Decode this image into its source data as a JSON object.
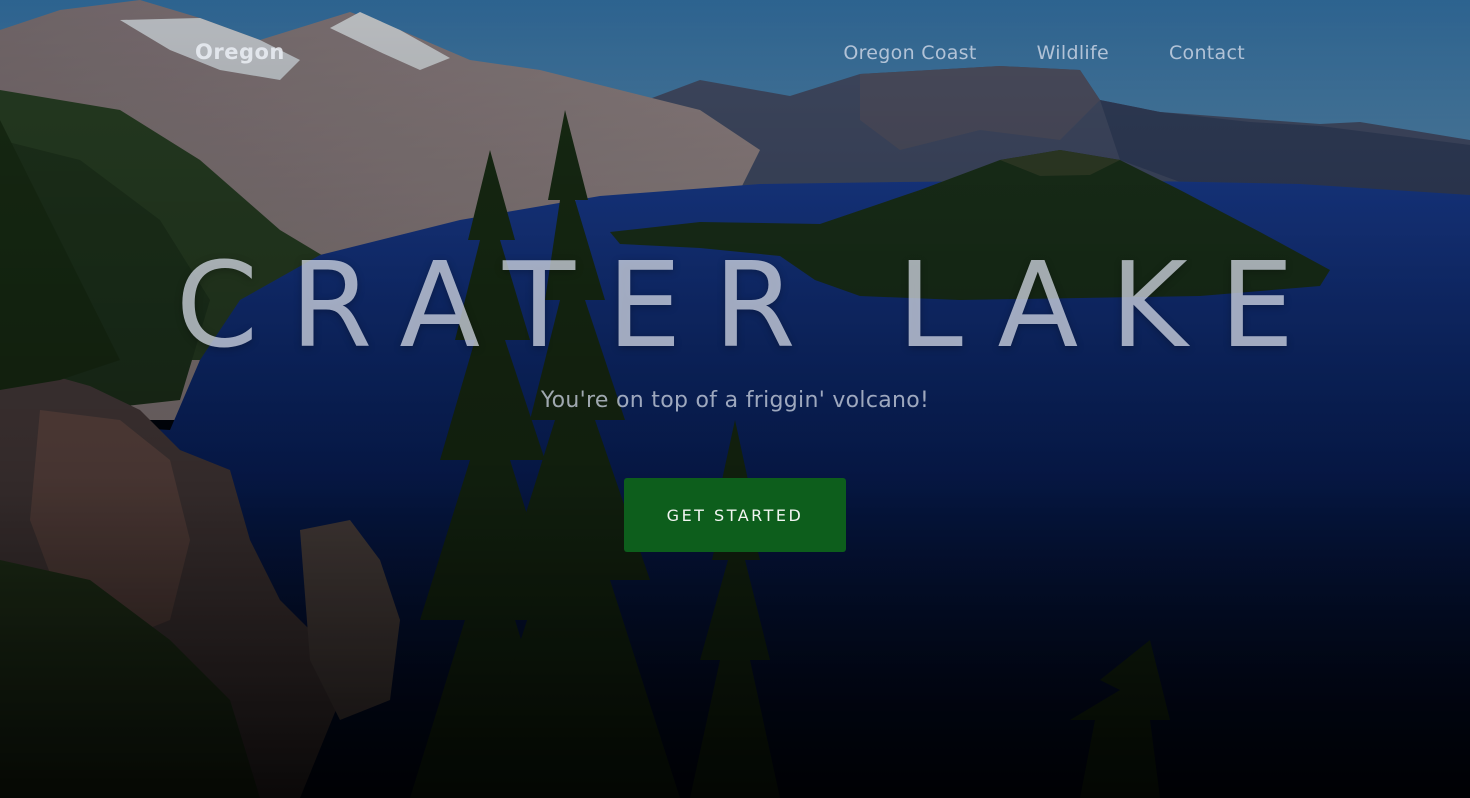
{
  "nav": {
    "brand": "Oregon",
    "links": [
      {
        "label": "Oregon Coast"
      },
      {
        "label": "Wildlife"
      },
      {
        "label": "Contact"
      }
    ]
  },
  "hero": {
    "title": "CRATER LAKE",
    "subtitle": "You're on top of a friggin' volcano!",
    "cta_label": "GET STARTED"
  },
  "colors": {
    "cta_background": "#0d5e1c",
    "lake": "#0b2a78",
    "sky": "#4a8fc4"
  }
}
